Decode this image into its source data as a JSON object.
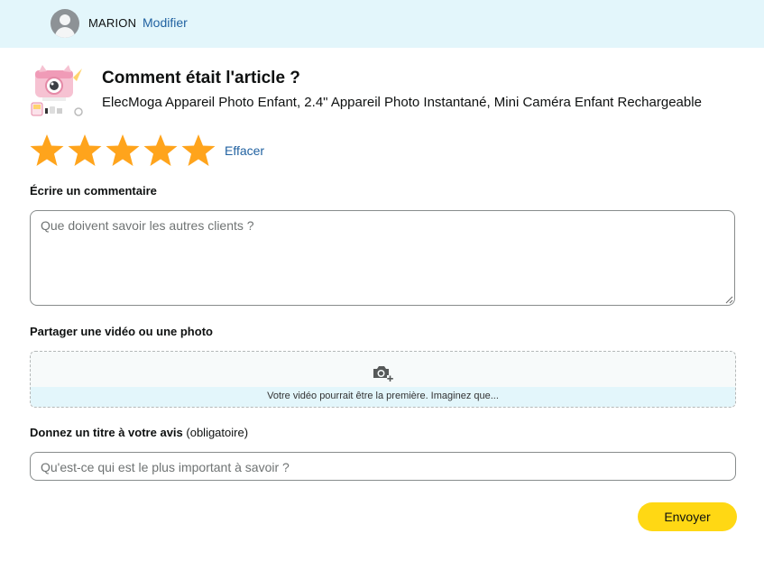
{
  "header": {
    "user_name": "MARION",
    "edit_link": "Modifier"
  },
  "product": {
    "question": "Comment était l'article ?",
    "name": "ElecMoga Appareil Photo Enfant, 2.4\" Appareil Photo Instantané, Mini Caméra Enfant Rechargeable"
  },
  "rating": {
    "value": 5,
    "max": 5,
    "star_color": "#ffa41c",
    "clear_label": "Effacer"
  },
  "review": {
    "label": "Écrire un commentaire",
    "placeholder": "Que doivent savoir les autres clients ?"
  },
  "media": {
    "label": "Partager une vidéo ou une photo",
    "icon": "camera-add-icon",
    "hint": "Votre vidéo pourrait être la première. Imaginez que..."
  },
  "title_field": {
    "label": "Donnez un titre à votre avis",
    "note": "(obligatoire)",
    "placeholder": "Qu'est-ce qui est le plus important à savoir ?"
  },
  "submit": {
    "label": "Envoyer",
    "color": "#ffd814"
  },
  "colors": {
    "header_bg": "#e3f6fb",
    "link": "#2162a1"
  }
}
